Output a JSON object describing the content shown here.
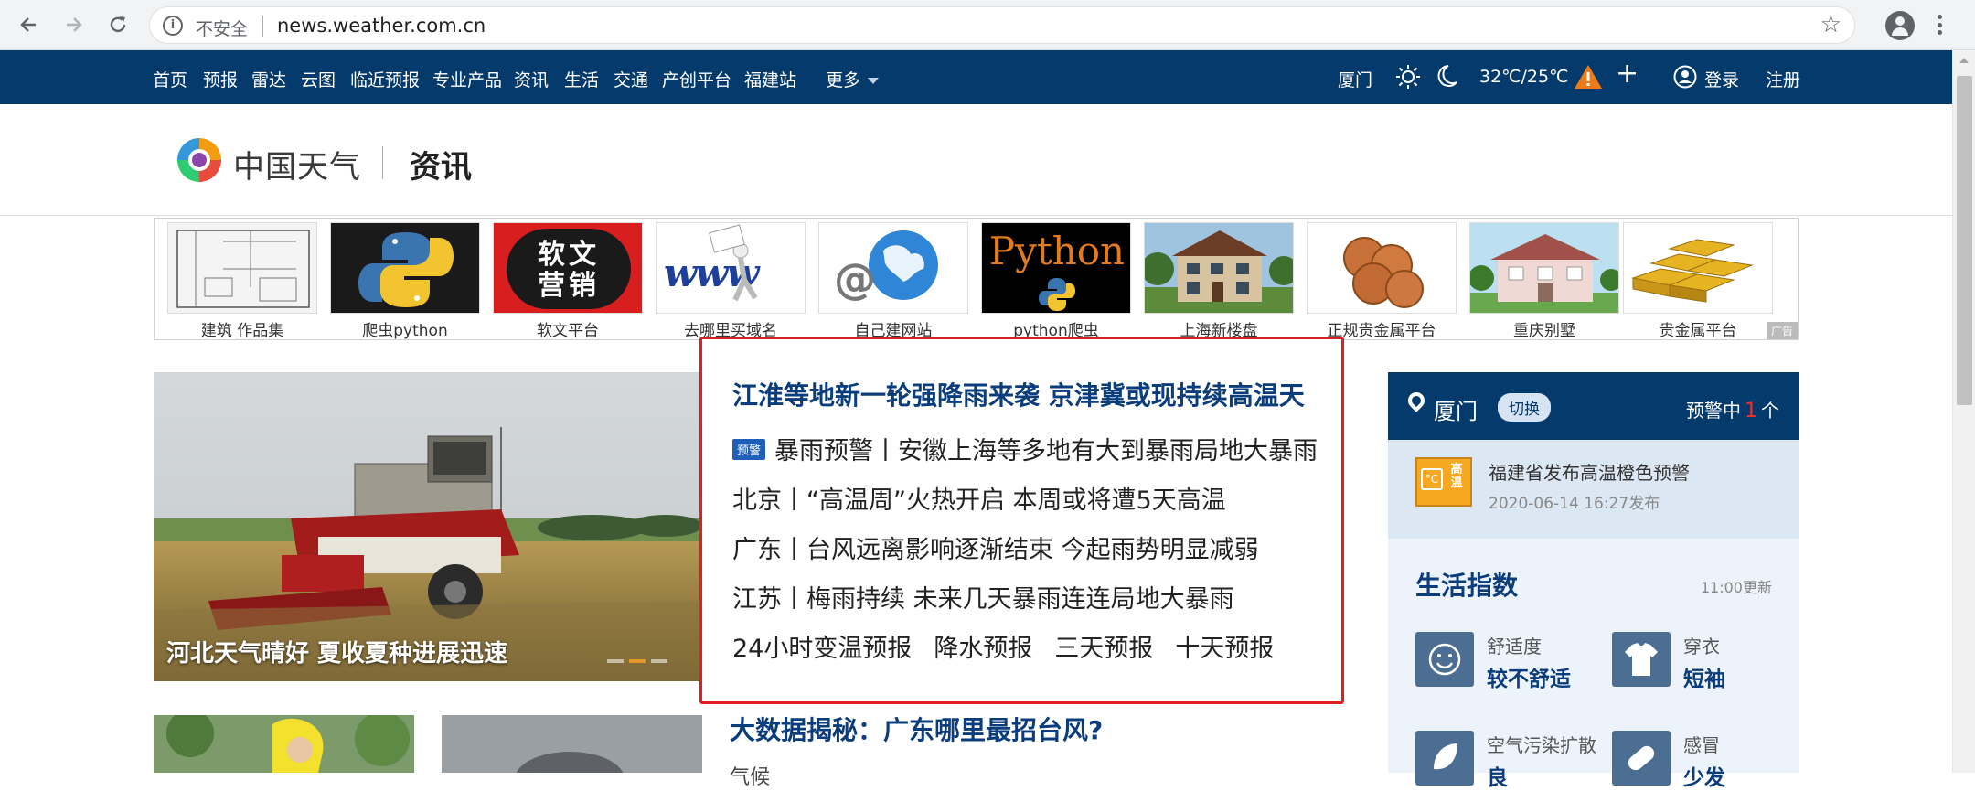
{
  "browser": {
    "security_label": "不安全",
    "url": "news.weather.com.cn"
  },
  "topnav": {
    "items": [
      "首页",
      "预报",
      "雷达",
      "云图",
      "临近预报",
      "专业产品",
      "资讯",
      "生活",
      "交通",
      "产创平台",
      "福建站"
    ],
    "more": "更多",
    "city": "厦门",
    "temperature": "32℃/25℃",
    "login": "登录",
    "register": "注册"
  },
  "header": {
    "logo_text": "中国天气",
    "section": "资讯"
  },
  "ads": {
    "items": [
      {
        "caption": "建筑 作品集",
        "text": ""
      },
      {
        "caption": "爬虫python",
        "text": ""
      },
      {
        "caption": "软文平台",
        "text": "软文营销"
      },
      {
        "caption": "去哪里买域名",
        "text": "www"
      },
      {
        "caption": "自己建网站",
        "text": "@"
      },
      {
        "caption": "python爬虫",
        "text": "Python"
      },
      {
        "caption": "上海新楼盘",
        "text": ""
      },
      {
        "caption": "正规贵金属平台",
        "text": ""
      },
      {
        "caption": "重庆别墅",
        "text": ""
      },
      {
        "caption": "贵金属平台",
        "text": ""
      }
    ],
    "badge": "广告"
  },
  "hero": {
    "caption": "河北天气晴好 夏收夏种进展迅速"
  },
  "headlines": {
    "main": "江淮等地新一轮强降雨来袭 京津冀或现持续高温天",
    "warning_tag": "预警",
    "lines": [
      "暴雨预警丨安徽上海等多地有大到暴雨局地大暴雨",
      "北京丨“高温周”火热开启 本周或将遭5天高温",
      "广东丨台风远离影响逐渐结束 今起雨势明显减弱",
      "江苏丨梅雨持续 未来几天暴雨连连局地大暴雨"
    ],
    "forecast_links": [
      "24小时变温预报",
      "降水预报",
      "三天预报",
      "十天预报"
    ]
  },
  "teaser": {
    "title": "大数据揭秘：广东哪里最招台风?",
    "subtitle": "气候"
  },
  "sidebar": {
    "city": "厦门",
    "switch": "切换",
    "warning_prefix": "预警中",
    "warning_count": "1",
    "warning_suffix": "个",
    "alert_icon_text": "高温",
    "alert_text": "福建省发布高温橙色预警",
    "alert_time": "2020-06-14 16:27发布",
    "life_title": "生活指数",
    "life_update": "11:00更新",
    "indices": [
      {
        "name": "舒适度",
        "value": "较不舒适"
      },
      {
        "name": "穿衣",
        "value": "短袖"
      },
      {
        "name": "空气污染扩散",
        "value": "良"
      },
      {
        "name": "感冒",
        "value": "少发"
      }
    ]
  },
  "colors": {
    "nav_bg": "#053a6c",
    "headline_blue": "#0b3d7c",
    "highlight_border": "#e02020",
    "warning_orange": "#f7a821"
  }
}
